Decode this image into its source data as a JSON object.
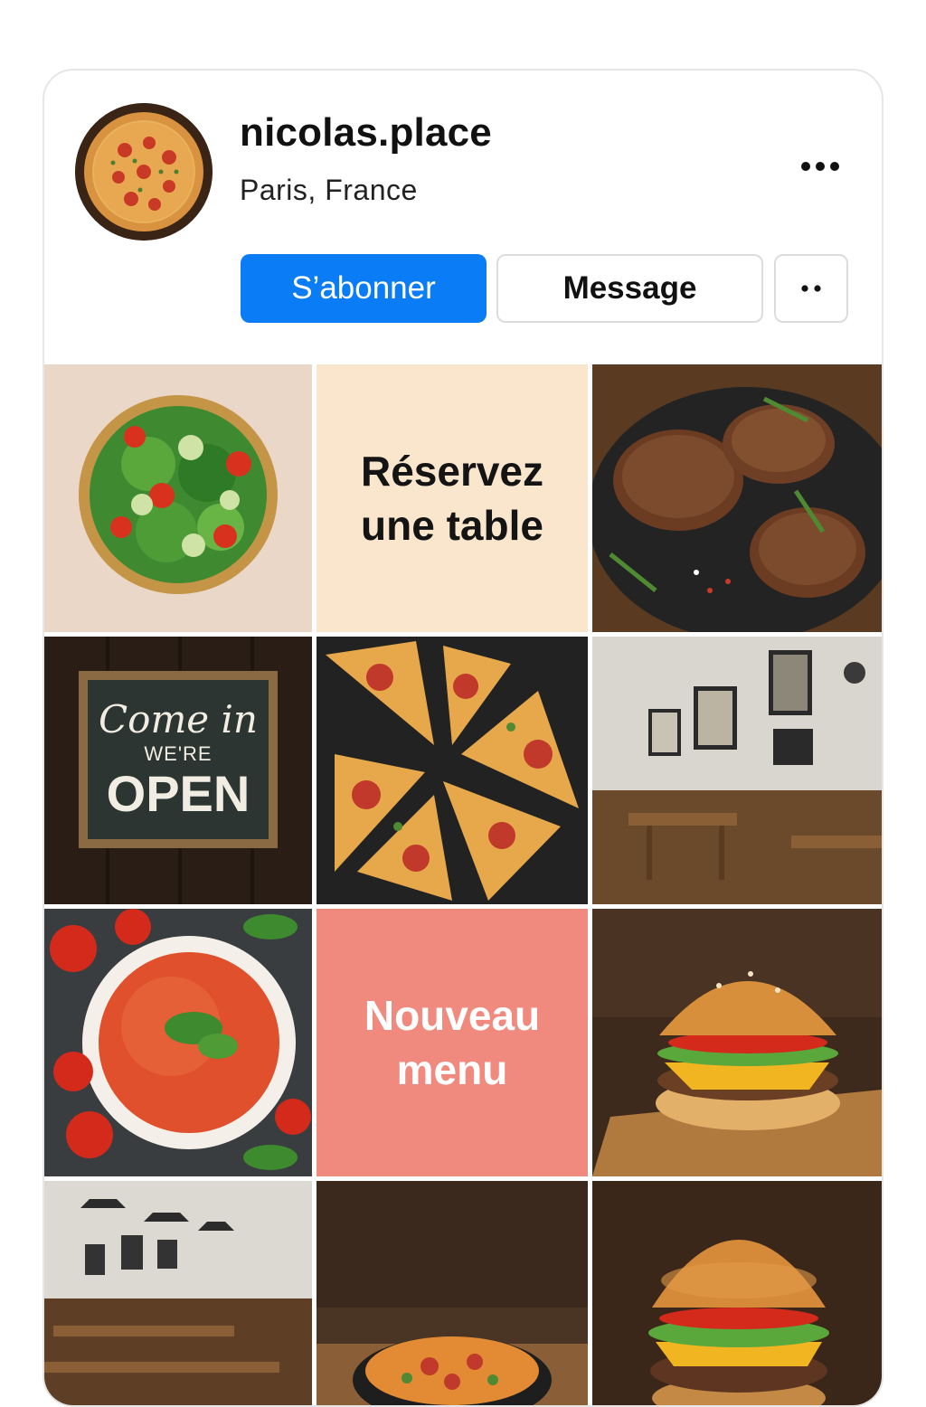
{
  "profile": {
    "username": "nicolas.place",
    "location": "Paris, France",
    "avatar_icon": "pizza-avatar"
  },
  "actions": {
    "follow_label": "S’abonner",
    "message_label": "Message",
    "more_icon": "more-horizontal-icon",
    "extra_icon": "two-dots-icon"
  },
  "colors": {
    "accent": "#0a7cf6",
    "reserve_bg": "#fae6cd",
    "new_menu_bg": "#f08a7e"
  },
  "grid": {
    "tiles": [
      {
        "kind": "photo",
        "subject": "salad bowl"
      },
      {
        "kind": "text",
        "line1": "Réservez",
        "line2": "une table"
      },
      {
        "kind": "photo",
        "subject": "grilled steaks"
      },
      {
        "kind": "photo",
        "subject": "open sign",
        "sign_line1": "Come in",
        "sign_line2": "WE'RE",
        "sign_line3": "OPEN"
      },
      {
        "kind": "photo",
        "subject": "pepperoni pizza slices"
      },
      {
        "kind": "photo",
        "subject": "restaurant interior"
      },
      {
        "kind": "photo",
        "subject": "tomato soup"
      },
      {
        "kind": "text",
        "line1": "Nouveau",
        "line2": "menu"
      },
      {
        "kind": "photo",
        "subject": "cheeseburger"
      },
      {
        "kind": "photo",
        "subject": "dining room with lamps"
      },
      {
        "kind": "photo",
        "subject": "pizza dish"
      },
      {
        "kind": "photo",
        "subject": "burger"
      }
    ]
  }
}
